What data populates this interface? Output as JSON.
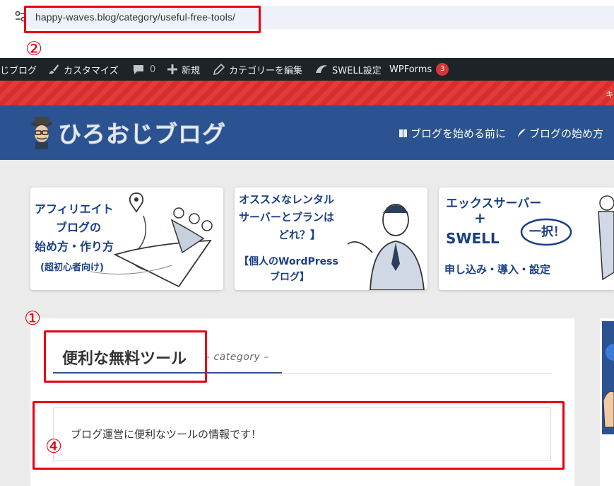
{
  "browser": {
    "url": "happy-waves.blog/category/useful-free-tools/"
  },
  "admin_bar": {
    "items": [
      {
        "label": "じブログ",
        "icon": "site-name"
      },
      {
        "label": "カスタマイズ",
        "icon": "brush-icon"
      },
      {
        "label": "0",
        "icon": "comment-icon"
      },
      {
        "label": "新規",
        "icon": "plus-icon"
      },
      {
        "label": "カテゴリーを編集",
        "icon": "pencil-icon"
      },
      {
        "label": "SWELL設定",
        "icon": "swell-icon"
      },
      {
        "label": "WPForms",
        "icon": "wpforms",
        "badge": "3"
      }
    ]
  },
  "notice": {
    "partial_text": "キ"
  },
  "header": {
    "logo_text": "ひろおじブログ",
    "nav": [
      {
        "label": "ブログを始める前に",
        "icon": "book-icon"
      },
      {
        "label": "ブログの始め方",
        "icon": "feather-icon"
      }
    ]
  },
  "banners": [
    {
      "lines": [
        "アフィリエイト",
        "ブログの",
        "始め方・作り方",
        "(超初心者向け)"
      ]
    },
    {
      "lines": [
        "オススメなレンタル",
        "サーバーとプランは",
        "どれ？】",
        "【個人のWordPress",
        "ブログ】"
      ]
    },
    {
      "lines": [
        "エックスサーバー",
        "+",
        "SWELL",
        "一択！",
        "申し込み・導入・設定"
      ]
    }
  ],
  "page": {
    "title": "便利な無料ツール",
    "subtitle": "– category –",
    "description": "ブログ運営に便利なツールの情報です！"
  },
  "annotations": [
    "①",
    "②",
    "④"
  ],
  "colors": {
    "admin_bar": "#1d2327",
    "header": "#2b5391",
    "stripe": "#e33a3a",
    "annotation": "#e60012",
    "badge": "#d63638"
  }
}
